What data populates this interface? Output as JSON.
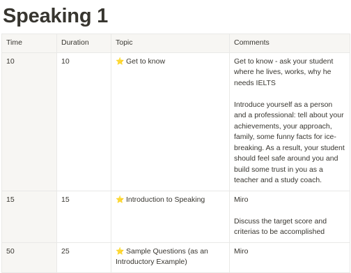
{
  "page": {
    "title": "Speaking 1"
  },
  "table": {
    "headers": [
      "Time",
      "Duration",
      "Topic",
      "Comments"
    ],
    "rows": [
      {
        "time": "10",
        "duration": "10",
        "topic": "Get to know",
        "topic_icon": "star-icon",
        "comments": [
          "Get to know - ask your student where he lives, works, why he needs IELTS",
          "Introduce yourself as a person and a professional: tell about your achievements, your approach, family, some funny facts for ice-breaking. As a result, your student should feel safe around you and build some trust in you as a teacher and a study coach."
        ]
      },
      {
        "time": "15",
        "duration": "15",
        "topic": "Introduction to Speaking",
        "topic_icon": "star-icon",
        "comments": [
          "Miro",
          "Discuss the target score and criterias to be accomplished"
        ]
      },
      {
        "time": "50",
        "duration": "25",
        "topic": "Sample Questions (as an Introductory Example)",
        "topic_icon": "star-icon",
        "comments": [
          "Miro"
        ]
      }
    ]
  },
  "colors": {
    "text": "#37352f",
    "header_bg": "#f7f6f3",
    "border": "#e9e9e7",
    "star": "#f4c430"
  }
}
